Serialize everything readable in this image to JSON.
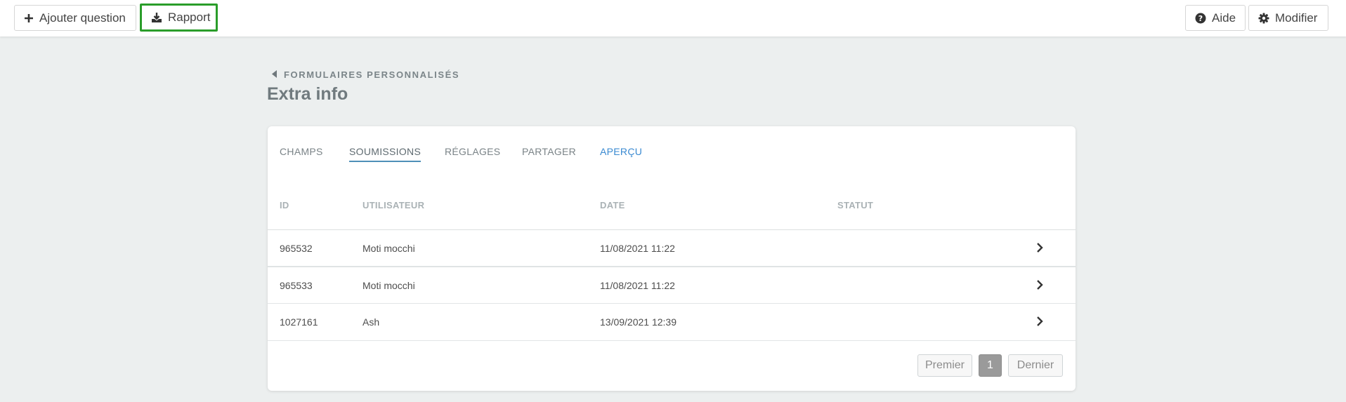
{
  "toolbar": {
    "add_question": "Ajouter question",
    "report": "Rapport",
    "help": "Aide",
    "edit": "Modifier",
    "report_highlight_color": "#2a9d2a"
  },
  "breadcrumb": {
    "label": "FORMULAIRES PERSONNALISÉS"
  },
  "page": {
    "title": "Extra info"
  },
  "tabs": [
    {
      "label": "CHAMPS"
    },
    {
      "label": "SOUMISSIONS"
    },
    {
      "label": "RÉGLAGES"
    },
    {
      "label": "PARTAGER"
    },
    {
      "label": "APERÇU"
    }
  ],
  "table": {
    "headers": [
      "ID",
      "UTILISATEUR",
      "DATE",
      "STATUT"
    ],
    "rows": [
      {
        "id": "965532",
        "user": "Moti mocchi",
        "date": "11/08/2021 11:22",
        "status": ""
      },
      {
        "id": "965533",
        "user": "Moti mocchi",
        "date": "11/08/2021 11:22",
        "status": ""
      },
      {
        "id": "1027161",
        "user": "Ash",
        "date": "13/09/2021 12:39",
        "status": ""
      }
    ]
  },
  "pagination": {
    "first": "Premier",
    "current": "1",
    "last": "Dernier"
  },
  "colors": {
    "accent_tab_underline": "#4e8fb8",
    "preview_link": "#3a8ad1",
    "background": "#ecefef"
  }
}
